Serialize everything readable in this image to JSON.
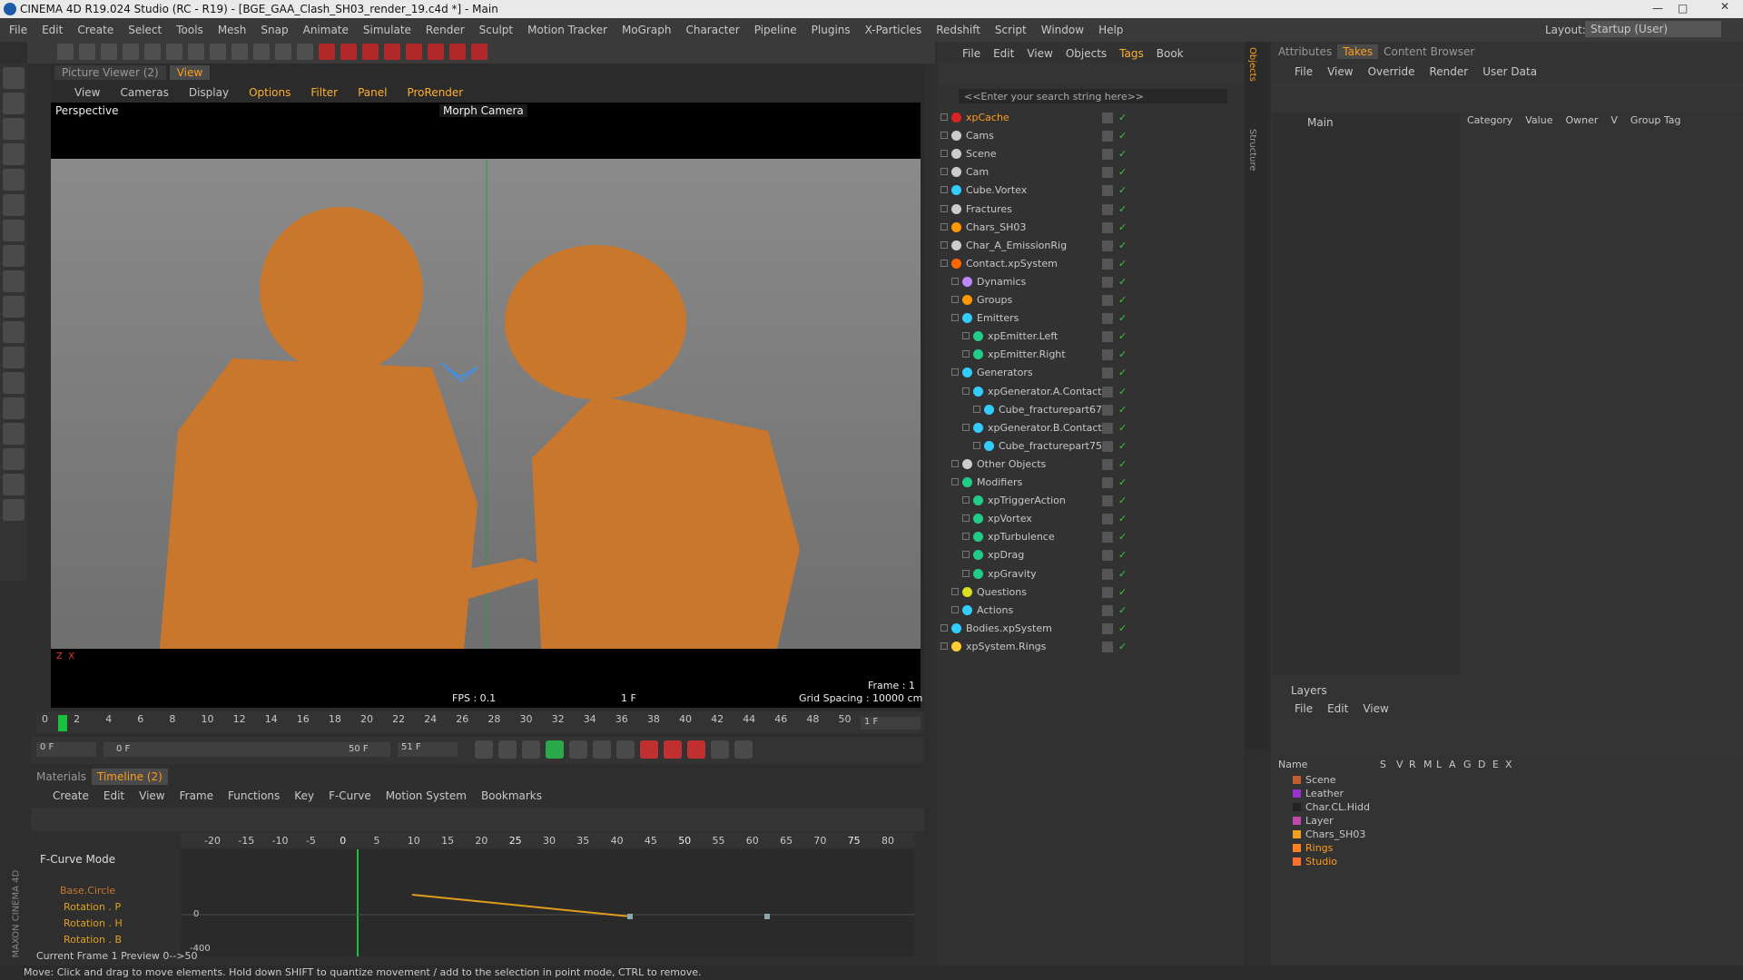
{
  "title": "CINEMA 4D R19.024 Studio (RC - R19) - [BGE_GAA_Clash_SH03_render_19.c4d *] - Main",
  "menu": [
    "File",
    "Edit",
    "Create",
    "Select",
    "Tools",
    "Mesh",
    "Snap",
    "Animate",
    "Simulate",
    "Render",
    "Sculpt",
    "Motion Tracker",
    "MoGraph",
    "Character",
    "Pipeline",
    "Plugins",
    "X-Particles",
    "Redshift",
    "Script",
    "Window",
    "Help"
  ],
  "layout": {
    "label": "Layout:",
    "value": "Startup (User)"
  },
  "viewport": {
    "tabs": [
      "Picture Viewer (2)",
      "View"
    ],
    "menu": [
      "View",
      "Cameras",
      "Display",
      "Options",
      "Filter",
      "Panel",
      "ProRender"
    ],
    "camera_label": "Perspective",
    "morph_camera": "Morph Camera",
    "fps": "FPS : 0.1",
    "frame_center": "1 F",
    "frame_label": "Frame : 1",
    "grid": "Grid Spacing : 10000 cm"
  },
  "timeline": {
    "ticks": [
      "0",
      "2",
      "4",
      "6",
      "8",
      "10",
      "12",
      "14",
      "16",
      "18",
      "20",
      "22",
      "24",
      "26",
      "28",
      "30",
      "32",
      "34",
      "36",
      "38",
      "40",
      "42",
      "44",
      "46",
      "48",
      "50"
    ],
    "end_field": "1 F",
    "start_field": "0 F",
    "range_start": "0 F",
    "range_end": "50 F",
    "max_field": "51 F"
  },
  "curve_editor": {
    "tabs": [
      "Materials",
      "Timeline (2)"
    ],
    "menu": [
      "Create",
      "Edit",
      "View",
      "Frame",
      "Functions",
      "Key",
      "F-Curve",
      "Motion System",
      "Bookmarks"
    ],
    "mode": "F-Curve Mode",
    "ticks": [
      "-20",
      "-15",
      "-10",
      "-5",
      "0",
      "5",
      "10",
      "15",
      "20",
      "25",
      "30",
      "35",
      "40",
      "45",
      "50",
      "55",
      "60",
      "65",
      "70",
      "75",
      "80"
    ],
    "tracks": [
      "Base.Circle",
      "Rotation . P",
      "Rotation . H",
      "Rotation . B"
    ],
    "y_zero": "0",
    "y_min": "-400",
    "status": "Current Frame  1  Preview  0-->50"
  },
  "objects": {
    "menu": [
      "File",
      "Edit",
      "View",
      "Objects",
      "Tags",
      "Book"
    ],
    "search_placeholder": "<<Enter your search string here>>",
    "items": [
      "xpCache",
      "Cams",
      "Scene",
      "Cam",
      "Cube.Vortex",
      "Fractures",
      "Chars_SH03",
      "Char_A_EmissionRig",
      "Contact.xpSystem",
      "Dynamics",
      "Groups",
      "Emitters",
      "xpEmitter.Left",
      "xpEmitter.Right",
      "Generators",
      "xpGenerator.A.Contact",
      "Cube_fracturepart67",
      "xpGenerator.B.Contact",
      "Cube_fracturepart75",
      "Other Objects",
      "Modifiers",
      "xpTriggerAction",
      "xpVortex",
      "xpTurbulence",
      "xpDrag",
      "xpGravity",
      "Questions",
      "Actions",
      "Bodies.xpSystem",
      "xpSystem.Rings"
    ],
    "side_tabs": [
      "Objects",
      "Structure"
    ]
  },
  "takes": {
    "tabs": [
      "Attributes",
      "Takes",
      "Content Browser"
    ],
    "menu": [
      "File",
      "View",
      "Override",
      "Render",
      "User Data"
    ],
    "main": "Main",
    "columns": [
      "Category",
      "Value",
      "Owner",
      "V",
      "Group Tag"
    ]
  },
  "layers": {
    "title": "Layers",
    "menu": [
      "File",
      "Edit",
      "View"
    ],
    "columns": [
      "Name",
      "S",
      "V",
      "R",
      "M",
      "L",
      "A",
      "G",
      "D",
      "E",
      "X"
    ],
    "items": [
      "Scene",
      "Leather",
      "Char.CL.Hidd",
      "Layer",
      "Chars_SH03",
      "Rings",
      "Studio"
    ]
  },
  "statusbar": "Move: Click and drag to move elements. Hold down SHIFT to quantize movement / add to the selection in point mode, CTRL to remove.",
  "maxon": "MAXON CINEMA 4D"
}
